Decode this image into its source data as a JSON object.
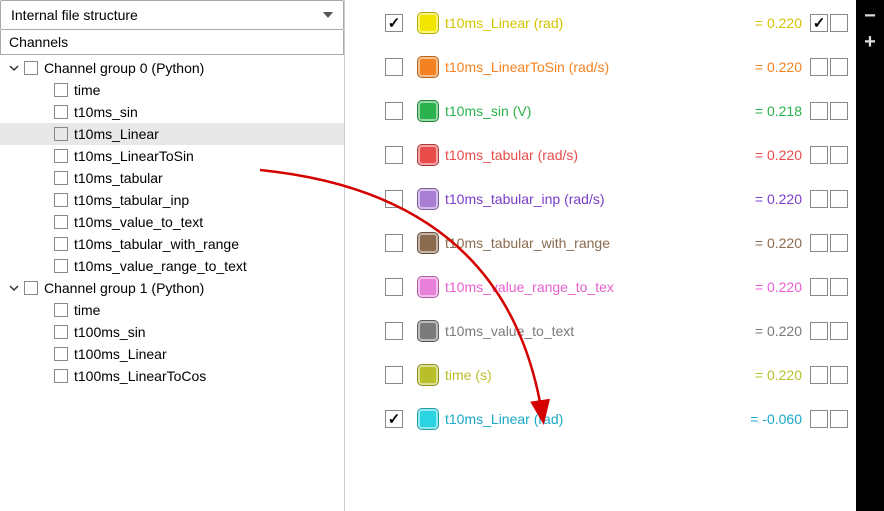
{
  "dropdown_label": "Internal file structure",
  "channels_label": "Channels",
  "tree": [
    {
      "label": "Channel group 0 (Python)",
      "expanded": true,
      "children": [
        {
          "label": "time"
        },
        {
          "label": "t10ms_sin"
        },
        {
          "label": "t10ms_Linear",
          "selected": true
        },
        {
          "label": "t10ms_LinearToSin"
        },
        {
          "label": "t10ms_tabular"
        },
        {
          "label": "t10ms_tabular_inp"
        },
        {
          "label": "t10ms_value_to_text"
        },
        {
          "label": "t10ms_tabular_with_range"
        },
        {
          "label": "t10ms_value_range_to_text"
        }
      ]
    },
    {
      "label": "Channel group 1 (Python)",
      "expanded": true,
      "children": [
        {
          "label": "time"
        },
        {
          "label": "t100ms_sin"
        },
        {
          "label": "t100ms_Linear"
        },
        {
          "label": "t100ms_LinearToCos"
        }
      ]
    }
  ],
  "channels": [
    {
      "checked": true,
      "color": "#f2e600",
      "textcolor": "#d4c300",
      "name": "t10ms_Linear (rad)",
      "value": "= 0.220",
      "tcb1": true,
      "tcb2": false
    },
    {
      "checked": false,
      "color": "#f58220",
      "textcolor": "#f58220",
      "name": "t10ms_LinearToSin (rad/s)",
      "value": "= 0.220",
      "tcb1": false,
      "tcb2": false
    },
    {
      "checked": false,
      "color": "#2bb24c",
      "textcolor": "#2bb24c",
      "name": "t10ms_sin (V)",
      "value": "= 0.218",
      "tcb1": false,
      "tcb2": false
    },
    {
      "checked": false,
      "color": "#e94b4b",
      "textcolor": "#e94b4b",
      "name": "t10ms_tabular (rad/s)",
      "value": "= 0.220",
      "tcb1": false,
      "tcb2": false
    },
    {
      "checked": false,
      "color": "#a87dd4",
      "textcolor": "#7a3ec8",
      "name": "t10ms_tabular_inp (rad/s)",
      "value": "= 0.220",
      "tcb1": false,
      "tcb2": false
    },
    {
      "checked": false,
      "color": "#8b6b50",
      "textcolor": "#8b6b50",
      "name": "t10ms_tabular_with_range",
      "value": "= 0.220",
      "tcb1": false,
      "tcb2": false
    },
    {
      "checked": false,
      "color": "#e87fd8",
      "textcolor": "#e85fd0",
      "name": "t10ms_value_range_to_tex",
      "value": "= 0.220",
      "tcb1": false,
      "tcb2": false
    },
    {
      "checked": false,
      "color": "#7a7a7a",
      "textcolor": "#7a7a7a",
      "name": "t10ms_value_to_text",
      "value": "= 0.220",
      "tcb1": false,
      "tcb2": false
    },
    {
      "checked": false,
      "color": "#b8bf2b",
      "textcolor": "#b8bf2b",
      "name": "time (s)",
      "value": "= 0.220",
      "tcb1": false,
      "tcb2": false
    },
    {
      "checked": true,
      "color": "#2bd4e0",
      "textcolor": "#1aa8c8",
      "name": "t10ms_Linear (rad)",
      "value": "= -0.060",
      "tcb1": false,
      "tcb2": false
    }
  ],
  "side_controls": {
    "minus": "−",
    "plus": "+"
  }
}
